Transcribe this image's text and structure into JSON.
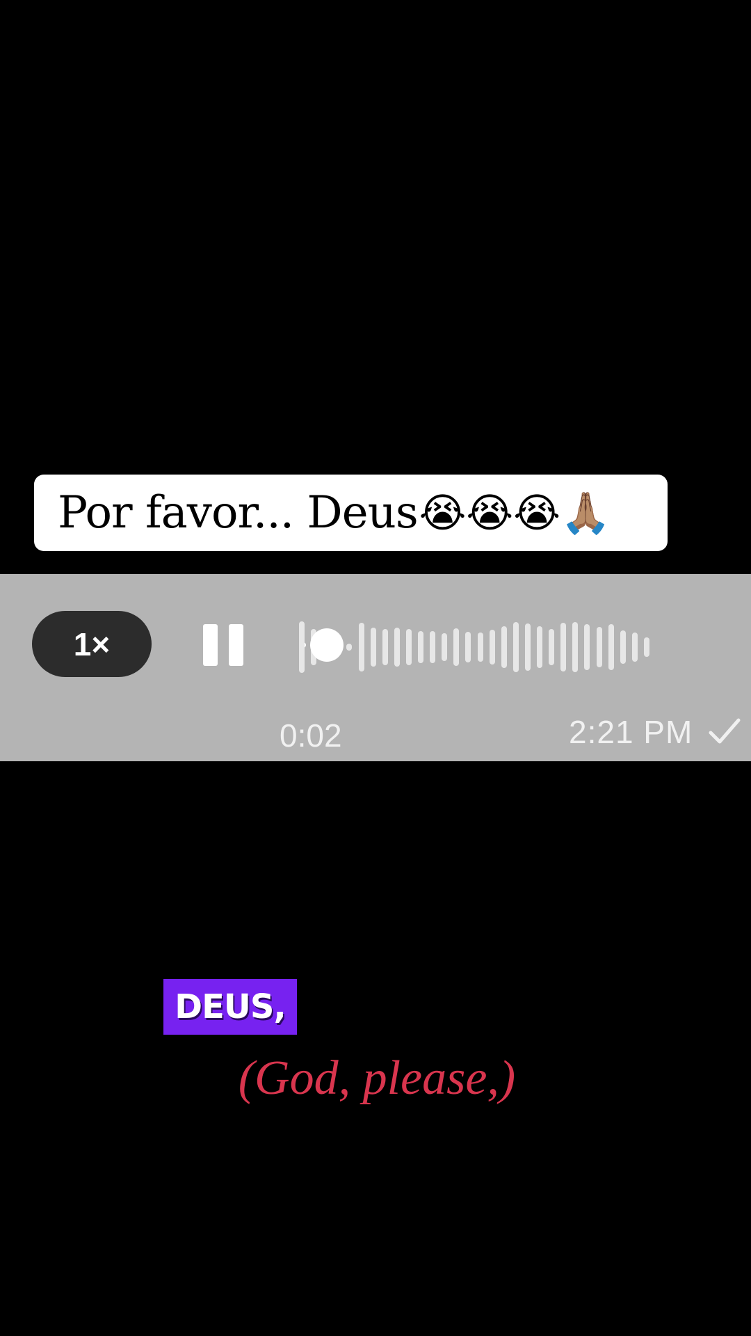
{
  "caption": {
    "text": "Por favor... Deus",
    "emojis": "😭😭😭🙏🏽"
  },
  "player": {
    "speed_label": "1×",
    "state": "playing",
    "progress": 0.05,
    "elapsed": "0:02",
    "timestamp": "2:21 PM",
    "pause_icon": "pause-icon",
    "status_icon": "checkmark-icon",
    "colors": {
      "background": "#b4b4b4",
      "waveform": "#e7e7e7",
      "speed_pill": "#2c2c2c"
    },
    "waveform_levels": [
      0.78,
      0.55,
      0.4,
      0.3,
      0.1,
      0.72,
      0.58,
      0.55,
      0.58,
      0.55,
      0.48,
      0.48,
      0.42,
      0.56,
      0.45,
      0.44,
      0.52,
      0.62,
      0.74,
      0.7,
      0.62,
      0.54,
      0.72,
      0.74,
      0.68,
      0.6,
      0.68,
      0.5,
      0.44,
      0.3
    ]
  },
  "subtitle": {
    "word": "DEUS,",
    "highlight_color": "#7722f0",
    "translation": "(God, please,)",
    "translation_color": "#d9354e"
  }
}
